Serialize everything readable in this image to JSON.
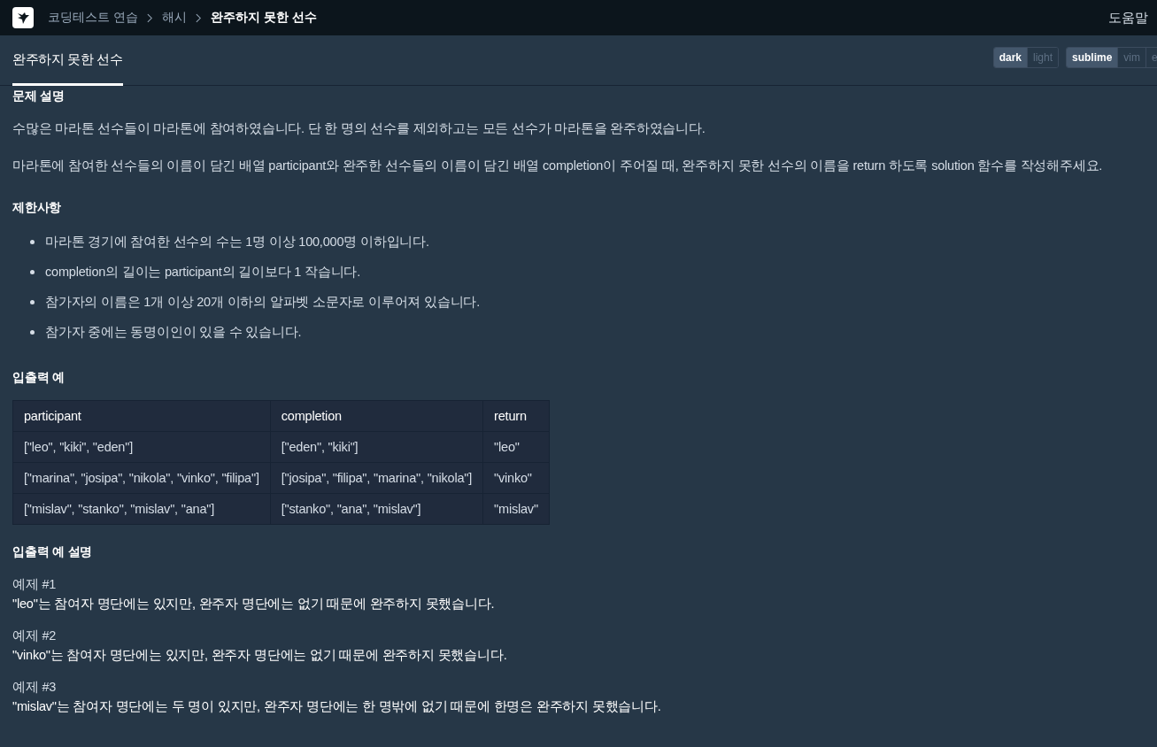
{
  "breadcrumb": [
    {
      "label": "코딩테스트 연습",
      "current": false
    },
    {
      "label": "해시",
      "current": false
    },
    {
      "label": "완주하지 못한 선수",
      "current": true
    }
  ],
  "help": "도움말",
  "tab": {
    "label": "완주하지 못한 선수",
    "selected": true
  },
  "theme_toggle": [
    {
      "label": "dark",
      "selected": true
    },
    {
      "label": "light",
      "selected": false
    }
  ],
  "editor_toggle": [
    {
      "label": "sublime",
      "selected": true
    },
    {
      "label": "vim",
      "selected": false
    },
    {
      "label": "e",
      "selected": false
    }
  ],
  "sections": [
    {
      "kind": "heading",
      "text": "문제 설명"
    },
    {
      "kind": "paragraph",
      "text": "수많은 마라톤 선수들이 마라톤에 참여하였습니다. 단 한 명의 선수를 제외하고는 모든 선수가 마라톤을 완주하였습니다."
    },
    {
      "kind": "paragraph",
      "text": "마라톤에 참여한 선수들의 이름이 담긴 배열 participant와 완주한 선수들의 이름이 담긴 배열 completion이 주어질 때, 완주하지 못한 선수의 이름을 return 하도록 solution 함수를 작성해주세요."
    },
    {
      "kind": "heading",
      "text": "제한사항"
    },
    {
      "kind": "list",
      "items": [
        "마라톤 경기에 참여한 선수의 수는 1명 이상 100,000명 이하입니다.",
        "completion의 길이는 participant의 길이보다 1 작습니다.",
        "참가자의 이름은 1개 이상 20개 이하의 알파벳 소문자로 이루어져 있습니다.",
        "참가자 중에는 동명이인이 있을 수 있습니다."
      ]
    },
    {
      "kind": "heading",
      "text": "입출력 예"
    },
    {
      "kind": "table",
      "columns": [
        "participant",
        "completion",
        "return"
      ],
      "rows": [
        [
          "[\"leo\", \"kiki\", \"eden\"]",
          "[\"eden\", \"kiki\"]",
          "\"leo\""
        ],
        [
          "[\"marina\", \"josipa\", \"nikola\", \"vinko\", \"filipa\"]",
          "[\"josipa\", \"filipa\", \"marina\", \"nikola\"]",
          "\"vinko\""
        ],
        [
          "[\"mislav\", \"stanko\", \"mislav\", \"ana\"]",
          "[\"stanko\", \"ana\", \"mislav\"]",
          "\"mislav\""
        ]
      ]
    },
    {
      "kind": "heading",
      "text": "입출력 예 설명"
    },
    {
      "kind": "example",
      "title": "예제 #1",
      "text": "\"leo\"는 참여자 명단에는 있지만, 완주자 명단에는 없기 때문에 완주하지 못했습니다."
    },
    {
      "kind": "example",
      "title": "예제 #2",
      "text": "\"vinko\"는 참여자 명단에는 있지만, 완주자 명단에는 없기 때문에 완주하지 못했습니다."
    },
    {
      "kind": "example",
      "title": "예제 #3",
      "text": "\"mislav\"는 참여자 명단에는 두 명이 있지만, 완주자 명단에는 한 명밖에 없기 때문에 한명은 완주하지 못했습니다."
    }
  ]
}
